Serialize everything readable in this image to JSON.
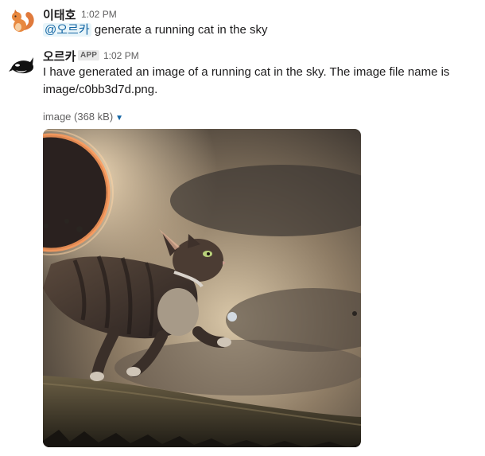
{
  "messages": [
    {
      "sender": "이태호",
      "time": "1:02 PM",
      "mention": "@오르카",
      "text": "generate a running cat in the sky",
      "avatar_icon": "squirrel-icon"
    },
    {
      "sender": "오르카",
      "badge": "APP",
      "time": "1:02 PM",
      "text_line1": "I have generated an image of a running cat in the sky. The image file name is",
      "text_line2": "image/c0bb3d7d.png.",
      "avatar_icon": "orca-icon",
      "attachment": {
        "label": "image (368 kB)",
        "caret_icon": "caret-down-icon"
      }
    }
  ],
  "colors": {
    "mention_bg": "#e8f5fa",
    "mention_text": "#1264a3",
    "muted": "#616061"
  }
}
